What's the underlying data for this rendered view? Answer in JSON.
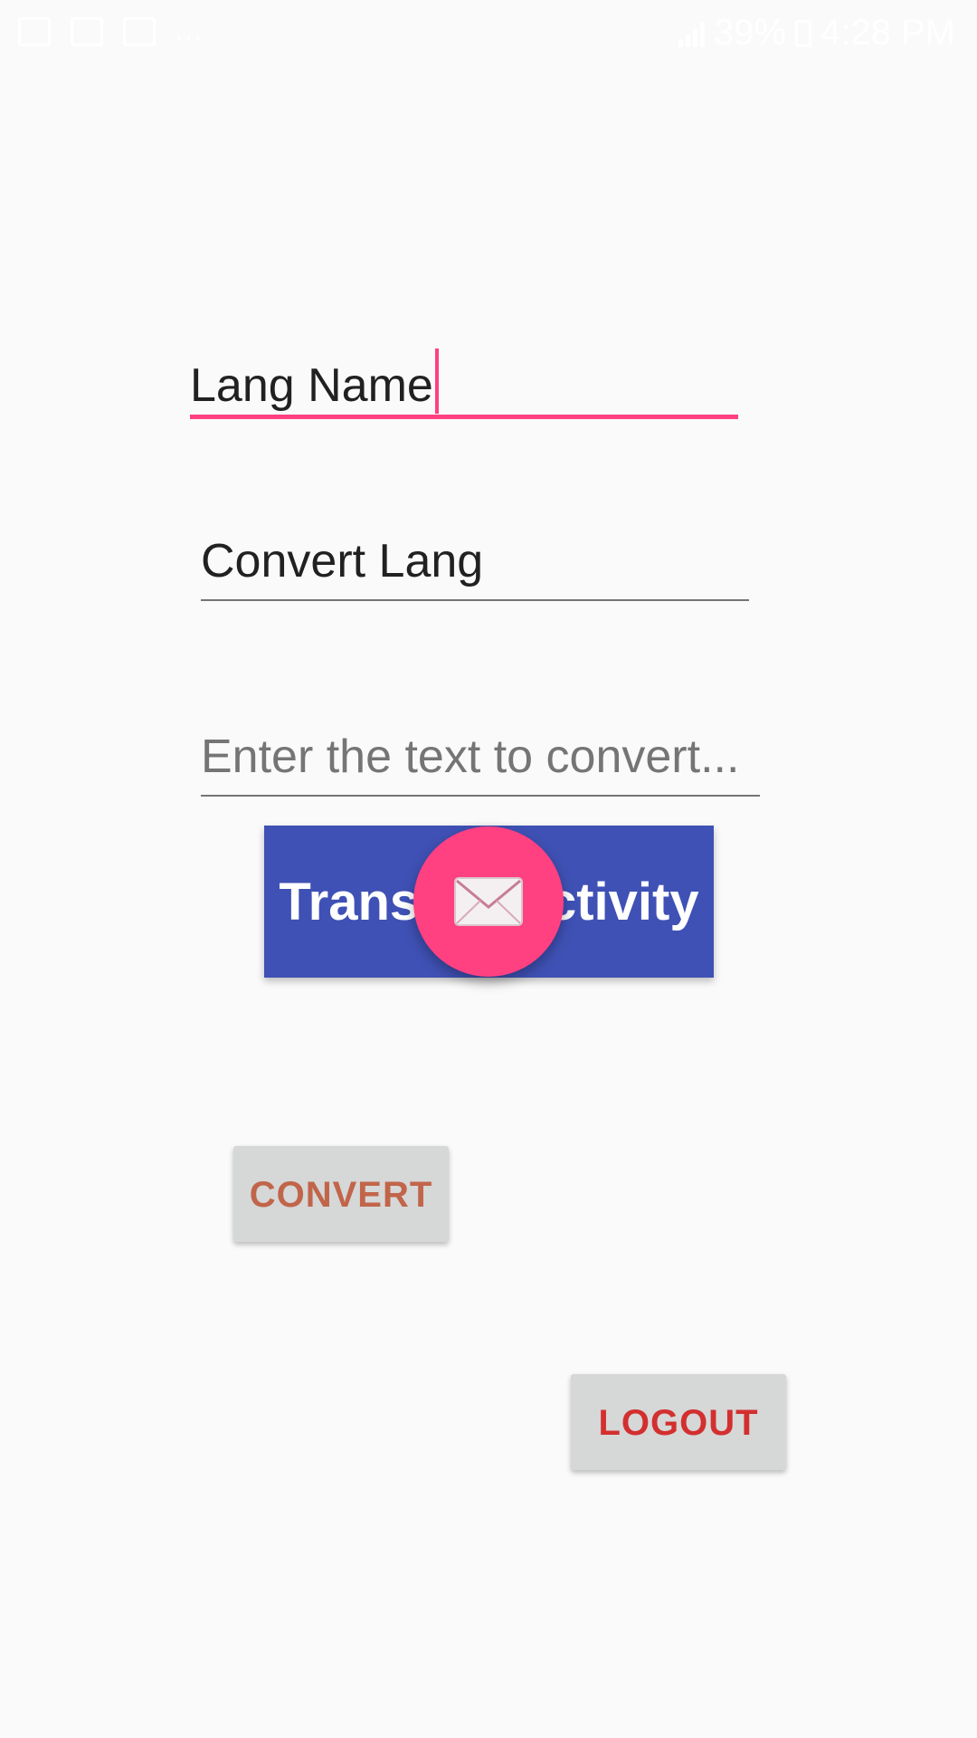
{
  "status_bar": {
    "overflow_dots": "...",
    "battery_percent": "39%",
    "time": "4:28 PM"
  },
  "form": {
    "lang_name": {
      "value": "Lang Name"
    },
    "convert_lang": {
      "value": "Convert Lang"
    },
    "text_input": {
      "placeholder": "Enter the text to convert..."
    }
  },
  "buttons": {
    "translate_activity": "TranslateActivity",
    "convert": "CONVERT",
    "logout": "LOGOUT"
  },
  "fab": {
    "icon": "envelope-icon"
  },
  "colors": {
    "accent": "#ff4081",
    "primary": "#3f51b5",
    "convert_text": "#c1654a",
    "logout_text": "#d32f2f"
  }
}
